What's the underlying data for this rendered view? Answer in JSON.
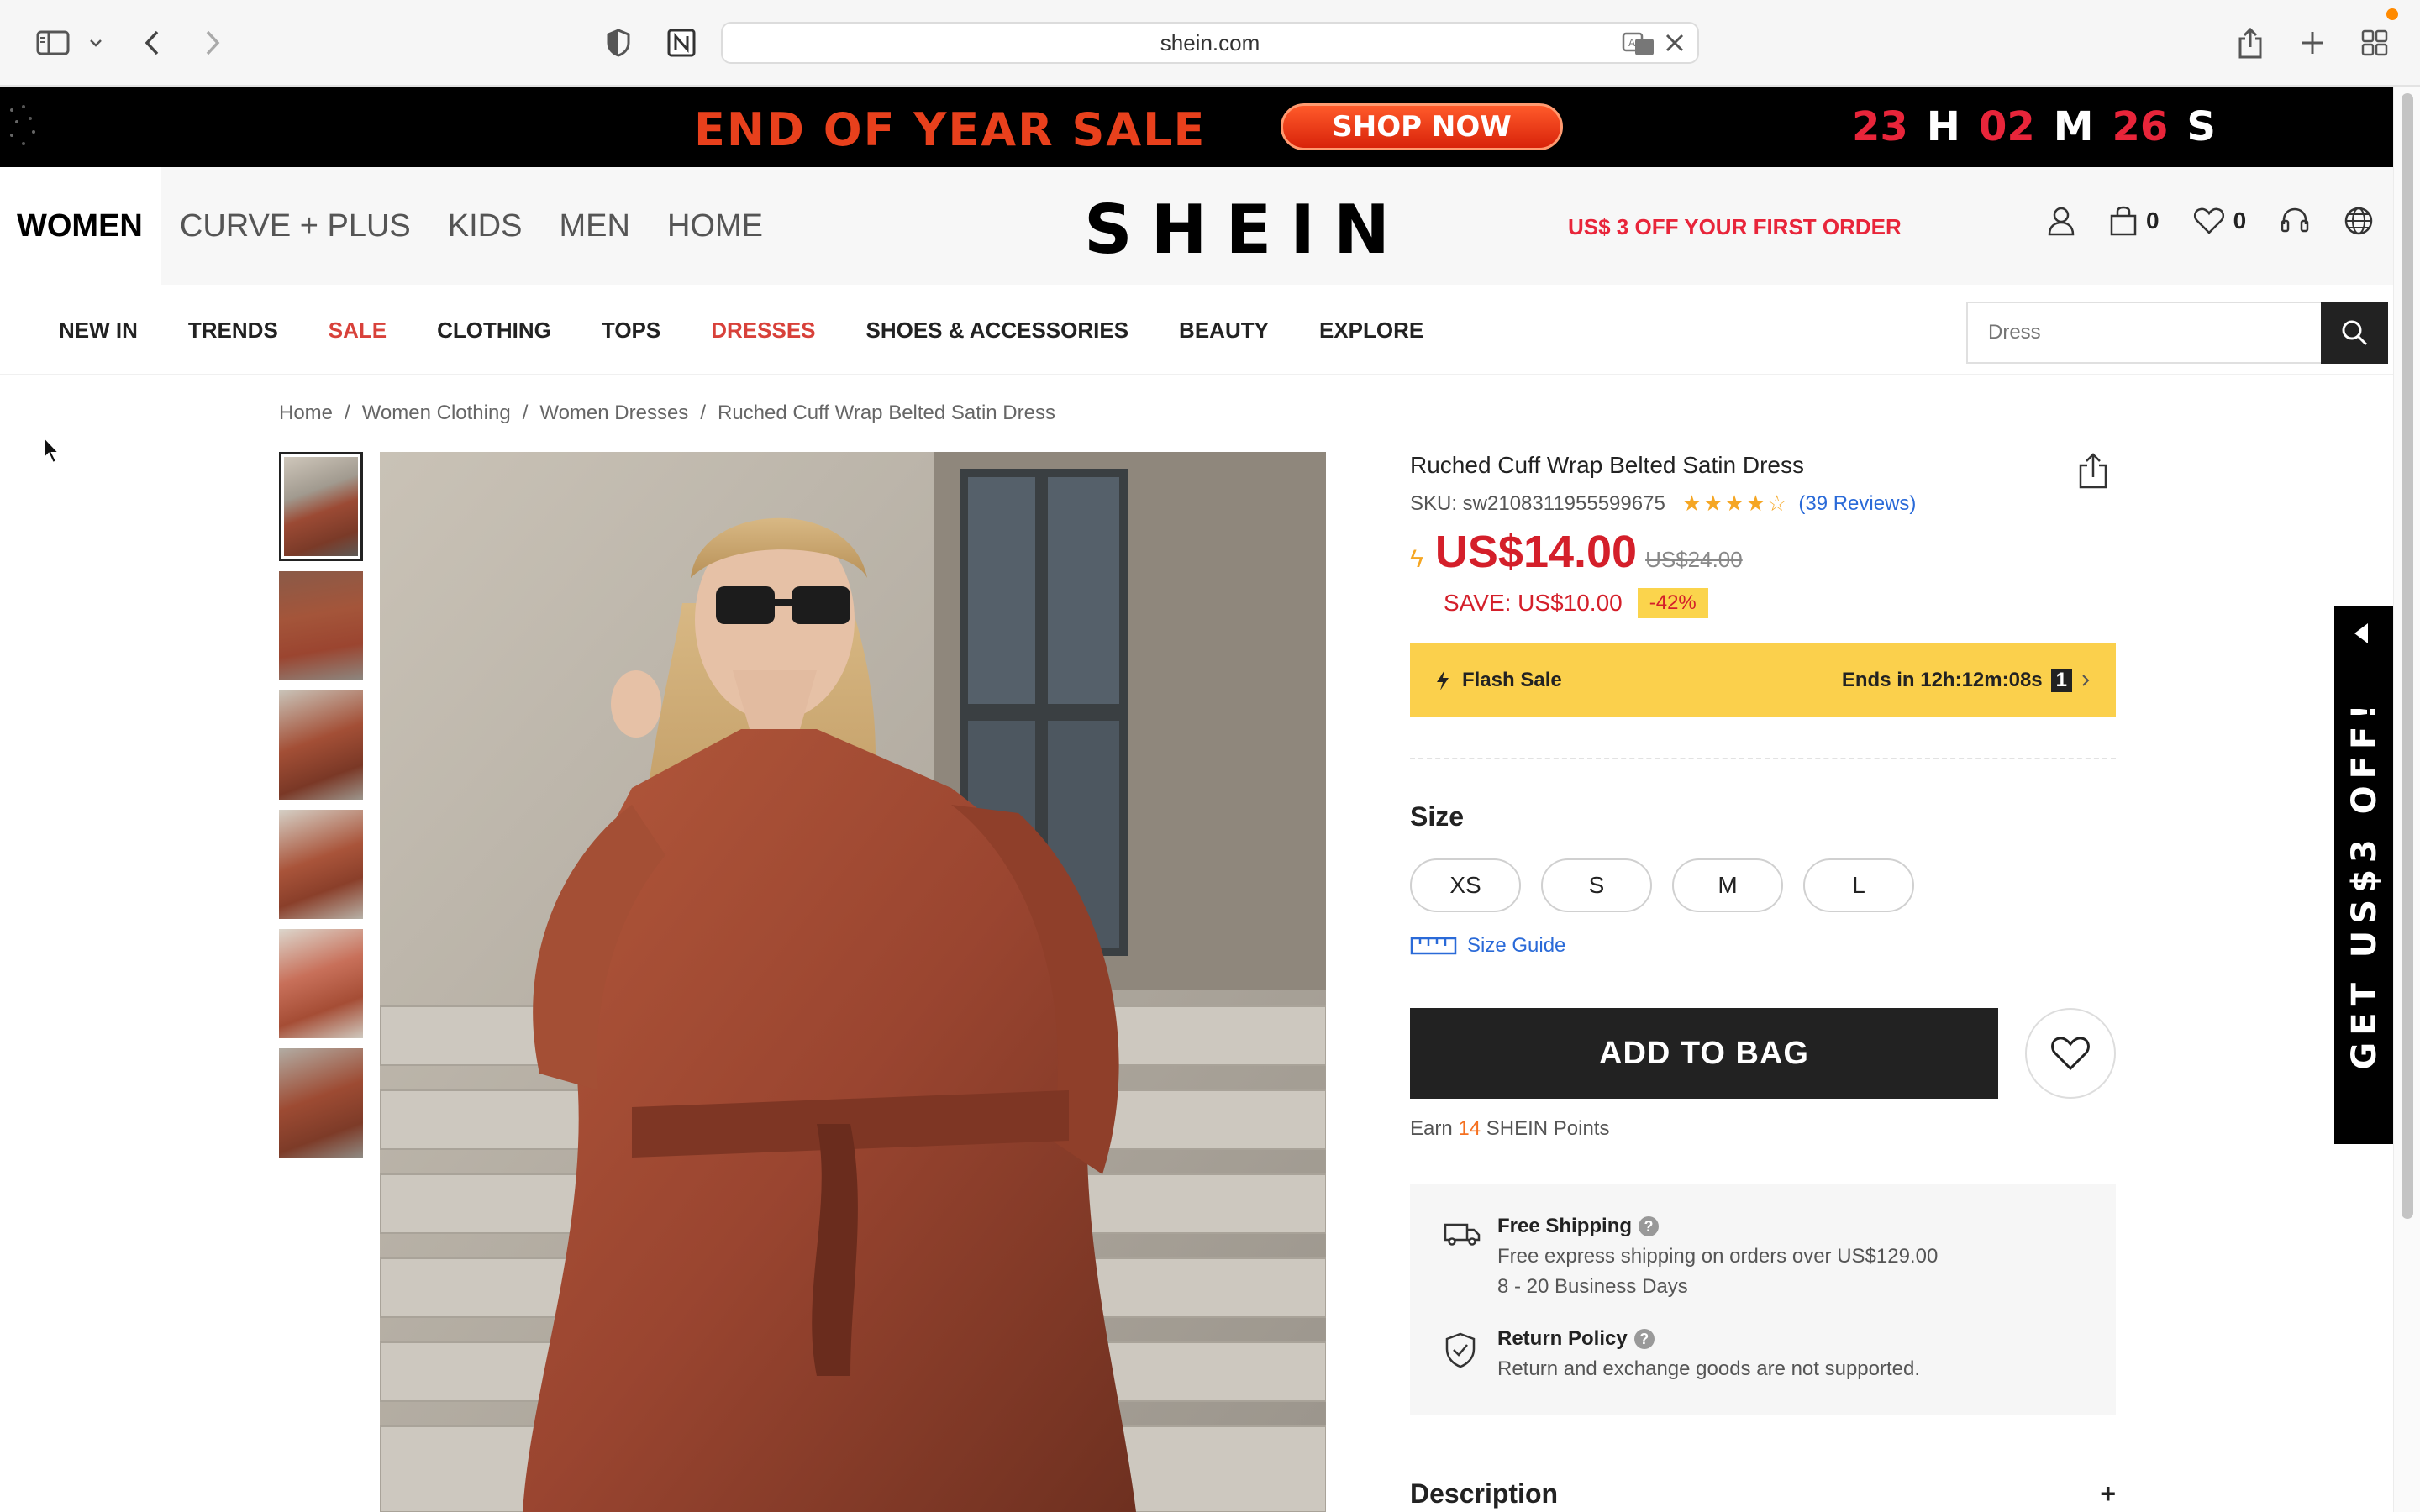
{
  "browser": {
    "url": "shein.com",
    "icons": [
      "sidebar-icon",
      "chevron-down-icon",
      "back-icon",
      "forward-icon",
      "shield-icon",
      "notion-icon",
      "translate-icon",
      "close-icon",
      "share-icon",
      "plus-icon",
      "tabs-grid-icon"
    ]
  },
  "promo": {
    "title": "END OF YEAR SALE",
    "cta": "SHOP NOW",
    "countdown": [
      {
        "value": "23",
        "unit": "H"
      },
      {
        "value": "02",
        "unit": "M"
      },
      {
        "value": "26",
        "unit": "S"
      }
    ],
    "colors": {
      "title": "#e8401c",
      "cta": "#e8401c",
      "countdown": "#e8253a"
    }
  },
  "header": {
    "categories": [
      "WOMEN",
      "CURVE + PLUS",
      "KIDS",
      "MEN",
      "HOME"
    ],
    "active_category": "WOMEN",
    "logo": "SHEIN",
    "first_order": "US$ 3 OFF YOUR FIRST ORDER",
    "bag_count": "0",
    "wishlist_count": "0"
  },
  "subnav": {
    "items": [
      {
        "label": "NEW IN",
        "highlight": false
      },
      {
        "label": "TRENDS",
        "highlight": false
      },
      {
        "label": "SALE",
        "highlight": true
      },
      {
        "label": "CLOTHING",
        "highlight": false
      },
      {
        "label": "TOPS",
        "highlight": false
      },
      {
        "label": "DRESSES",
        "highlight": true
      },
      {
        "label": "SHOES & ACCESSORIES",
        "highlight": false
      },
      {
        "label": "BEAUTY",
        "highlight": false
      },
      {
        "label": "EXPLORE",
        "highlight": false
      }
    ],
    "search_placeholder": "Dress"
  },
  "breadcrumb": [
    {
      "label": "Home",
      "sep": "/"
    },
    {
      "label": "Women Clothing",
      "sep": "/"
    },
    {
      "label": "Women Dresses",
      "sep": "/"
    },
    {
      "label": "Ruched Cuff Wrap Belted Satin Dress",
      "sep": ""
    }
  ],
  "product": {
    "title": "Ruched Cuff Wrap Belted Satin Dress",
    "sku": "SKU: sw2108311955599675",
    "rating": 4,
    "reviews": "(39 Reviews)",
    "price": "US$14.00",
    "old_price": "US$24.00",
    "save": "SAVE: US$10.00",
    "discount": "-42%",
    "flash_label": "Flash Sale",
    "flash_ends": "Ends in 12h:12m:08s",
    "flash_count": "1",
    "size_title": "Size",
    "sizes": [
      "XS",
      "S",
      "M",
      "L"
    ],
    "size_guide": "Size Guide",
    "add_to_bag": "ADD TO BAG",
    "points_prefix": "Earn",
    "points_value": "14",
    "points_suffix": "SHEIN Points",
    "shipping_title": "Free Shipping",
    "shipping_line1": "Free express shipping on orders over US$129.00",
    "shipping_line2": "8 - 20 Business Days",
    "return_title": "Return Policy",
    "return_line": "Return and exchange goods are not supported.",
    "description": "Description",
    "thumbnail_count": 6,
    "colors": {
      "price": "#d41f2a",
      "flash": "#fbd04c",
      "link": "#2a6ad8"
    }
  },
  "side_tab": {
    "text": "GET US$3 OFF!"
  }
}
